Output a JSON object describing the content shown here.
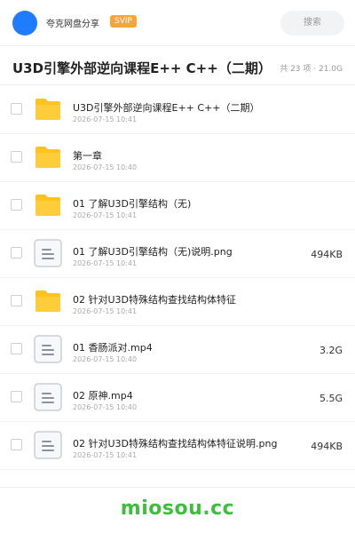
{
  "header": {
    "user_name": "夸克网盘分享",
    "badge": "SVIP",
    "search_label": "搜索"
  },
  "folder": {
    "title": "U3D引擎外部逆向课程E++ C++（二期）",
    "summary": "共 23 项 · 21.0G"
  },
  "files": [
    {
      "type": "folder",
      "name": "U3D引擎外部逆向课程E++ C++（二期）",
      "date": "2026-07-15 10:41",
      "size": ""
    },
    {
      "type": "folder",
      "name": "第一章",
      "date": "2026-07-15 10:40",
      "size": ""
    },
    {
      "type": "folder",
      "name": "01 了解U3D引擎结构（无)",
      "date": "2026-07-15 10:41",
      "size": ""
    },
    {
      "type": "file",
      "name": "01 了解U3D引擎结构（无)说明.png",
      "date": "2026-07-15 10:41",
      "size": "494KB"
    },
    {
      "type": "folder",
      "name": "02 针对U3D特殊结构查找结构体特征",
      "date": "2026-07-15 10:41",
      "size": ""
    },
    {
      "type": "file",
      "name": "01 香肠派对.mp4",
      "date": "2026-07-15 10:40",
      "size": "3.2G"
    },
    {
      "type": "file",
      "name": "02 原神.mp4",
      "date": "2026-07-15 10:40",
      "size": "5.5G"
    },
    {
      "type": "file",
      "name": "02 针对U3D特殊结构查找结构体特征说明.png",
      "date": "2026-07-15 10:41",
      "size": "494KB"
    }
  ],
  "watermark": "miosou.cc",
  "colors": {
    "avatar": "#1f7cff",
    "badge": "#f6a53a",
    "folder": "#ffc31f",
    "watermark": "#3dbf3d"
  }
}
